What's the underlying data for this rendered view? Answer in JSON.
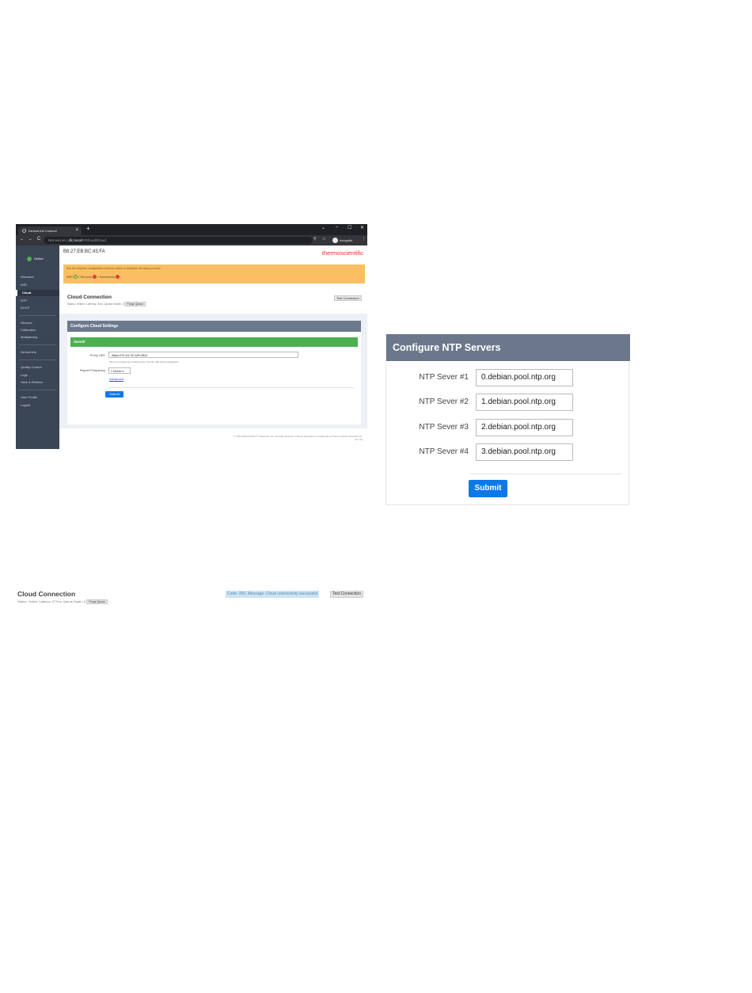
{
  "browser": {
    "tab_title": "DeviceLink Connect",
    "tab_close": "×",
    "new_tab": "+",
    "win_minimize": "–",
    "win_maximize": "☐",
    "win_close": "✕",
    "win_chevron": "⌄",
    "nav_back": "←",
    "nav_forward": "→",
    "nav_reload": "C",
    "not_secure": "Not secure",
    "url_host": "dlc.local",
    "url_path": "/#!/Cloud/Cloud",
    "incognito": "Incognito"
  },
  "sidebar": {
    "status": "Online",
    "items": [
      "Welcome",
      "WiFi",
      "Cloud",
      "NTP",
      "DHCP",
      "Sensors",
      "Calibration",
      "Multiplexing",
      "DeviceLink",
      "Quality Control",
      "Logs",
      "Save & Restore",
      "User Profile",
      "Logout"
    ],
    "active": "Cloud"
  },
  "header": {
    "mac": "B8:27:EB:BC:43:FA",
    "logo_a": "thermo",
    "logo_b": "scientific"
  },
  "banner": {
    "message": "See the required configuration sections below to complete the setup process.",
    "step1": "WiFi",
    "step2": "Sensors",
    "step3": "DeviceLink",
    "sep": "/"
  },
  "cloud": {
    "title": "Cloud Connection",
    "status": "Status: Online, Latency: 0ms, Queue Depth: 0",
    "purge_label": "Purge Queue",
    "test_label": "Test Connection"
  },
  "config": {
    "title": "Configure Cloud Settings",
    "saved": "Saved!",
    "proxy_label": "Proxy URL",
    "proxy_value": "https://70.24.78.129:2812",
    "proxy_help": "Set if you require an outside proxy. Format: http://user:pass@host",
    "freq_label": "Report Frequency",
    "freq_value": "1 Minute",
    "advanced": "Advanced",
    "submit": "Submit"
  },
  "footer": {
    "line1": "© 2012-2020 RUPTU™ Networks, Inc. All rights reserved. Thermo Scientific is a trademark of Thermo Fisher Scientific Inc.",
    "line2": "v2.1.24"
  },
  "ntp": {
    "title": "Configure NTP Servers",
    "servers": [
      {
        "label": "NTP Sever #1",
        "value": "0.debian.pool.ntp.org"
      },
      {
        "label": "NTP Sever #2",
        "value": "1.debian.pool.ntp.org"
      },
      {
        "label": "NTP Sever #3",
        "value": "2.debian.pool.ntp.org"
      },
      {
        "label": "NTP Sever #4",
        "value": "3.debian.pool.ntp.org"
      }
    ],
    "submit": "Submit"
  },
  "cloud_bar": {
    "title": "Cloud Connection",
    "status": "Status: Online, Latency: 277ms, Queue Depth: 0",
    "purge_label": "Purge Queue",
    "message": "Code: 200, Message: Cloud connectivity successful",
    "test_label": "Test Connection"
  },
  "colors": {
    "sidebar_bg": "#3a4555",
    "banner_bg": "#f9bf62",
    "panel_header": "#6b788b",
    "success_green": "#4caf50",
    "primary_blue": "#0d79e8",
    "brand_red": "#e42f2f"
  }
}
